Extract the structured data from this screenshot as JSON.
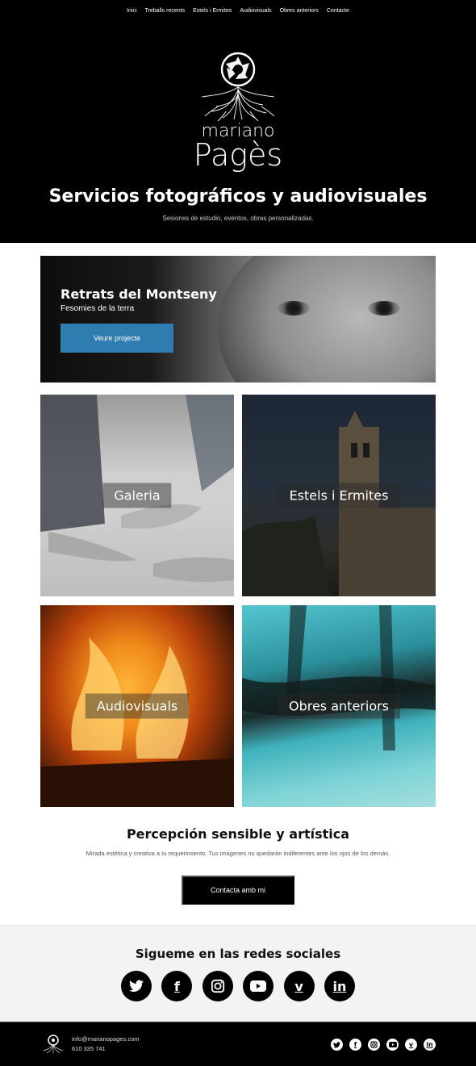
{
  "nav": {
    "items": [
      "Inici",
      "Treballs recents",
      "Estels i Ermites",
      "Audiovisuals",
      "Obres anteriors",
      "Contacte"
    ]
  },
  "hero": {
    "logo_line1": "mariano",
    "logo_line2": "Pagès",
    "title": "Servicios fotográficos y audiovisuales",
    "subtitle": "Sesiones de estudio, eventos, obras personalizadas.",
    "background_color": "#000000"
  },
  "feature": {
    "title": "Retrats del Montseny",
    "subtitle": "Fesomies de la terra",
    "button_label": "Veure projecte",
    "button_color": "#2f7db0"
  },
  "tiles": [
    {
      "label": "Galeria"
    },
    {
      "label": "Estels i Ermites"
    },
    {
      "label": "Audiovisuals"
    },
    {
      "label": "Obres anteriors"
    }
  ],
  "contact": {
    "title": "Percepción sensible y artística",
    "text": "Mirada estética y creativa a tu requerimiento. Tus imágenes no quedarán indiferentes ante los ojos de los demás.",
    "button_label": "Contacta amb mi"
  },
  "social": {
    "title": "Sigueme en las redes sociales",
    "icons": [
      "twitter-icon",
      "facebook-icon",
      "instagram-icon",
      "youtube-icon",
      "vimeo-icon",
      "linkedin-icon"
    ]
  },
  "footer": {
    "email": "info@marianopages.com",
    "phone": "610 335 741"
  }
}
